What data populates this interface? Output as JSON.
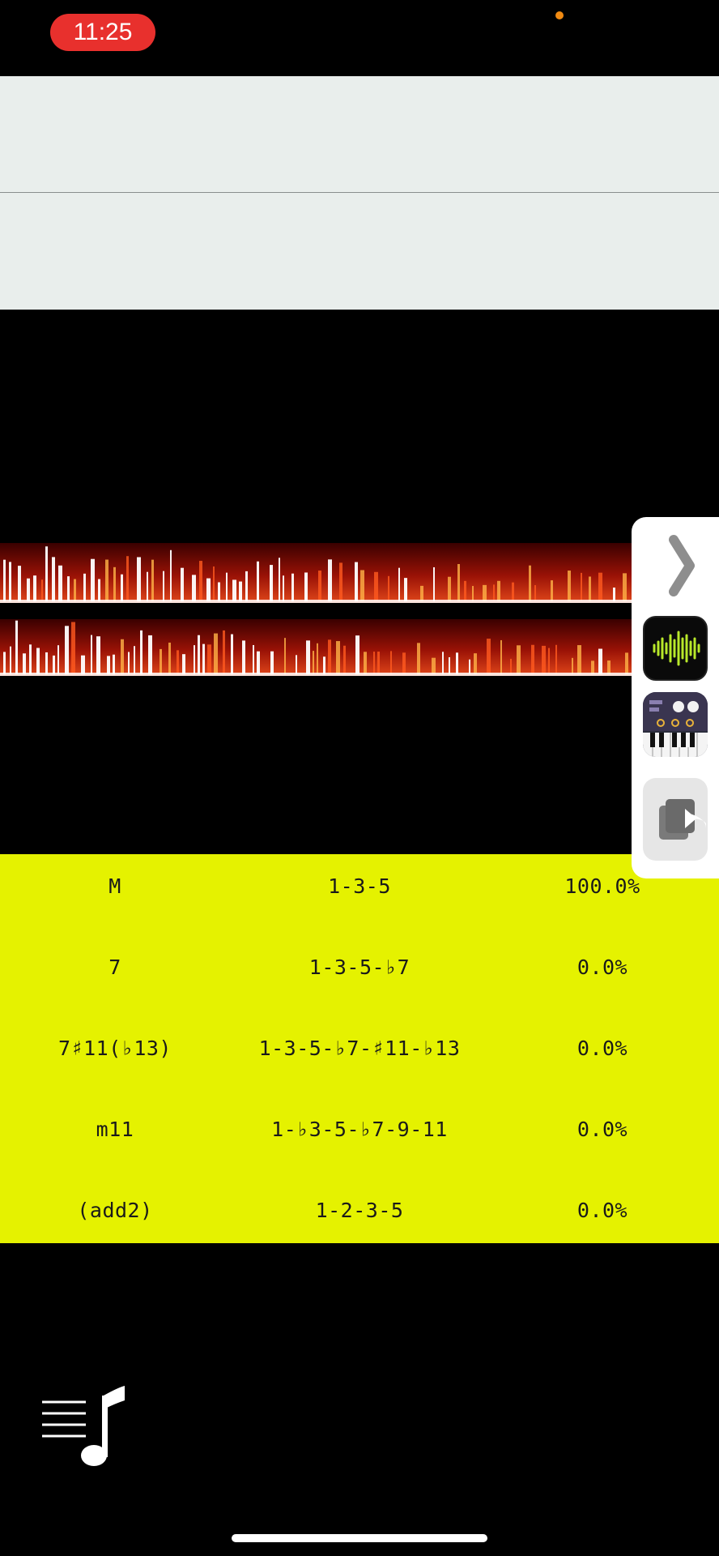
{
  "status_bar": {
    "time": "11:25"
  },
  "chord_table": {
    "rows": [
      {
        "name": "M",
        "formula": "1-3-5",
        "percent": "100.0%"
      },
      {
        "name": "7",
        "formula": "1-3-5-♭7",
        "percent": "0.0%"
      },
      {
        "name": "7♯11(♭13)",
        "formula": "1-3-5-♭7-♯11-♭13",
        "percent": "0.0%"
      },
      {
        "name": "m11",
        "formula": "1-♭3-5-♭7-9-11",
        "percent": "0.0%"
      },
      {
        "name": "(add2)",
        "formula": "1-2-3-5",
        "percent": "0.0%"
      }
    ]
  },
  "side_panel": {
    "apps": [
      {
        "icon": "waveform-app-icon"
      },
      {
        "icon": "synth-keyboard-app-icon"
      },
      {
        "icon": "share-extension-icon"
      }
    ]
  },
  "colors": {
    "table_background": "#e5f200",
    "staff_background": "#e9eeec",
    "time_pill": "#e8302d",
    "spectrogram_hot": "#ffffff",
    "spectrogram_mid": "#d42a10"
  }
}
